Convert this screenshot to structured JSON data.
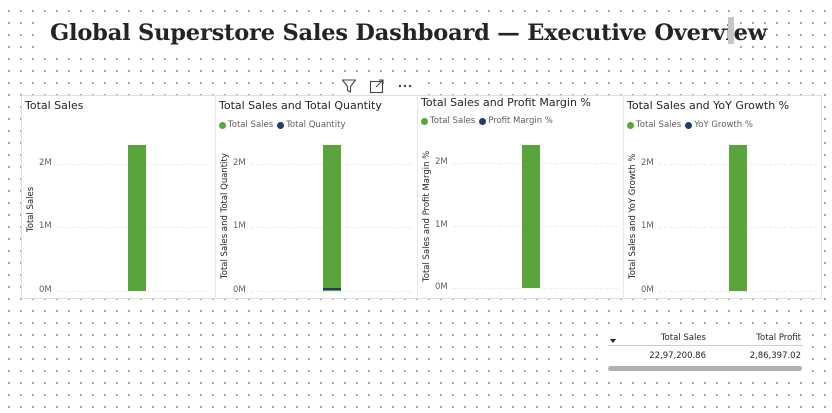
{
  "page": {
    "title": "Global Superstore Sales Dashboard — Executive Overview"
  },
  "visual_header": {
    "icons": [
      "filter-icon",
      "focus-mode-icon",
      "more-options-icon"
    ]
  },
  "colors": {
    "total_sales": "#59a53c",
    "secondary_series": "#243b6b",
    "grid": "#ececec"
  },
  "chart_data": [
    {
      "type": "bar",
      "title": "Total Sales",
      "ylabel": "Total Sales",
      "yticks": [
        "2M",
        "1M",
        "0M"
      ],
      "ylim": [
        0,
        2500000
      ],
      "legend": [],
      "series": [
        {
          "values": [
            2297200.86
          ]
        }
      ]
    },
    {
      "type": "bar",
      "title": "Total Sales and Total Quantity",
      "ylabel": "Total Sales and Total Quantity",
      "yticks": [
        "2M",
        "1M",
        "0M"
      ],
      "ylim": [
        0,
        2500000
      ],
      "legend": [
        "Total Sales",
        "Total Quantity"
      ],
      "series": [
        {
          "name": "Total Sales",
          "values": [
            2297200.86
          ]
        },
        {
          "name": "Total Quantity",
          "values": [
            38654
          ]
        }
      ]
    },
    {
      "type": "bar",
      "title": "Total Sales and Profit Margin %",
      "ylabel": "Total Sales and Profit Margin %",
      "yticks": [
        "2M",
        "1M",
        "0M"
      ],
      "ylim": [
        0,
        2500000
      ],
      "legend": [
        "Total Sales",
        "Profit Margin %"
      ],
      "series": [
        {
          "name": "Total Sales",
          "values": [
            2297200.86
          ]
        },
        {
          "name": "Profit Margin %",
          "values": [
            0
          ]
        }
      ]
    },
    {
      "type": "bar",
      "title": "Total Sales and YoY Growth %",
      "ylabel": "Total Sales and YoY Growth %",
      "yticks": [
        "2M",
        "1M",
        "0M"
      ],
      "ylim": [
        0,
        2500000
      ],
      "legend": [
        "Total Sales",
        "YoY Growth %"
      ],
      "series": [
        {
          "name": "Total Sales",
          "values": [
            2297200.86
          ]
        },
        {
          "name": "YoY Growth %",
          "values": [
            0
          ]
        }
      ]
    }
  ],
  "table": {
    "columns": [
      "Total Sales",
      "Total Profit"
    ],
    "rows": [
      [
        "22,97,200.86",
        "2,86,397.02"
      ]
    ]
  }
}
